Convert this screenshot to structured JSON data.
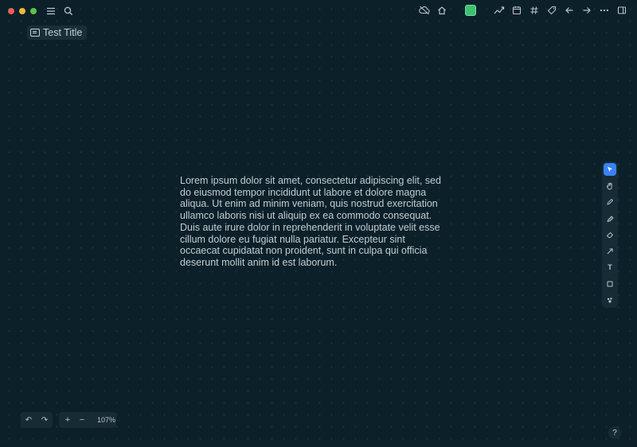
{
  "window": {
    "traffic_lights": [
      "close",
      "minimize",
      "zoom"
    ]
  },
  "toolbar_left": {
    "icons": [
      "menu-icon",
      "search-icon"
    ]
  },
  "toolbar_right": {
    "icons": [
      "cloud-off-icon",
      "home-icon",
      "green-status-square",
      "graph-icon",
      "calendar-icon",
      "hashtag-icon",
      "tag-icon",
      "back-arrow-icon",
      "forward-arrow-icon",
      "more-icon",
      "sidebar-icon"
    ]
  },
  "document": {
    "title": "Test Title"
  },
  "canvas": {
    "text": "Lorem ipsum dolor sit amet, consectetur adipiscing elit, sed do eiusmod tempor incididunt ut labore et dolore magna aliqua. Ut enim ad minim veniam, quis nostrud exercitation ullamco laboris nisi ut aliquip ex ea commodo consequat. Duis aute irure dolor in reprehenderit in voluptate velit esse cillum dolore eu fugiat nulla pariatur. Excepteur sint occaecat cupidatat non proident, sunt in culpa qui officia deserunt mollit anim id est laborum."
  },
  "tools": {
    "items": [
      "select-tool",
      "hand-tool",
      "pen-tool",
      "highlighter-tool",
      "eraser-tool",
      "arrow-tool",
      "text-tool",
      "rectangle-tool",
      "more-tools"
    ],
    "active": "select-tool",
    "text_tool_label": "T"
  },
  "zoom": {
    "undo": "↶",
    "redo": "↷",
    "plus": "+",
    "minus": "−",
    "level": "107%"
  },
  "help": {
    "label": "?"
  },
  "colors": {
    "background": "#0c2029",
    "accent": "#3b82f6",
    "status_green": "#3fbf6f"
  }
}
